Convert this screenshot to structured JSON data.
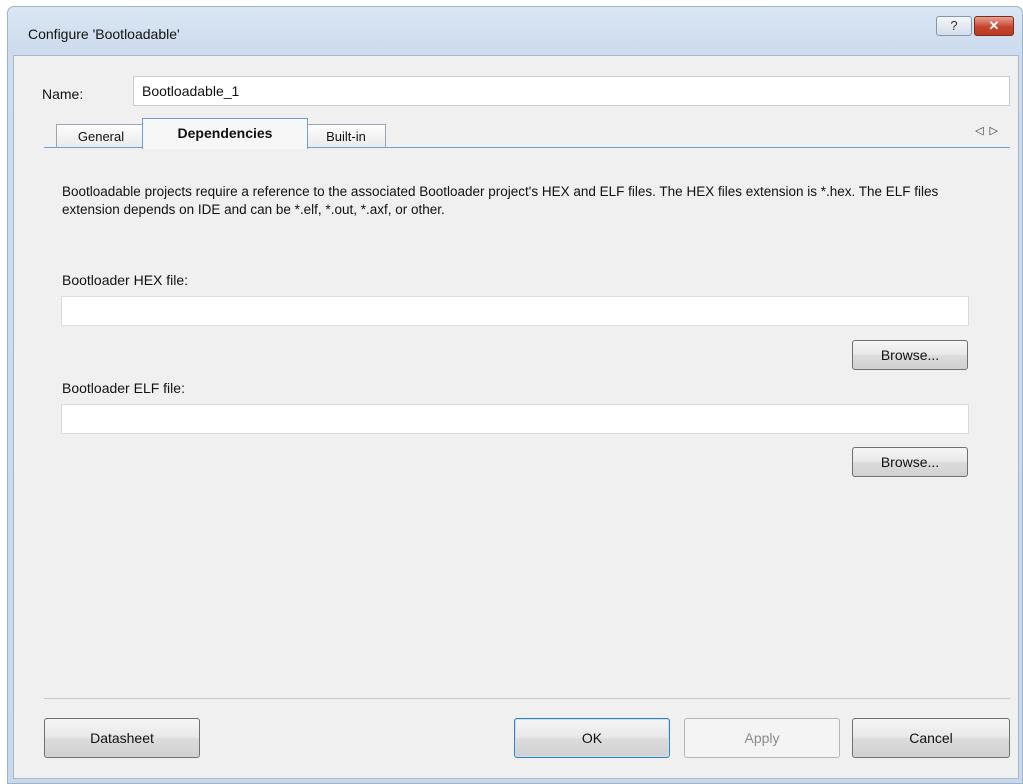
{
  "window": {
    "title": "Configure 'Bootloadable'",
    "help_glyph": "?",
    "close_glyph": "✕"
  },
  "name": {
    "label": "Name:",
    "value": "Bootloadable_1"
  },
  "tabs": [
    {
      "label": "General",
      "active": false
    },
    {
      "label": "Dependencies",
      "active": true
    },
    {
      "label": "Built-in",
      "active": false
    }
  ],
  "tab_nav": {
    "prev": "◁",
    "next": "▷"
  },
  "dependencies": {
    "description": "Bootloadable projects require a reference to the associated Bootloader project's HEX and ELF files. The HEX files extension is *.hex. The ELF files extension depends on IDE and can be *.elf, *.out, *.axf, or other.",
    "hex_label": "Bootloader HEX file:",
    "hex_value": "",
    "elf_label": "Bootloader ELF file:",
    "elf_value": "",
    "browse_label": "Browse..."
  },
  "buttons": {
    "datasheet": "Datasheet",
    "ok": "OK",
    "apply": "Apply",
    "cancel": "Cancel"
  },
  "colors": {
    "title_bar": "#cddcee",
    "close_button": "#c7452f",
    "tab_accent": "#6f9fd8",
    "client_bg": "#f0f0f0"
  }
}
